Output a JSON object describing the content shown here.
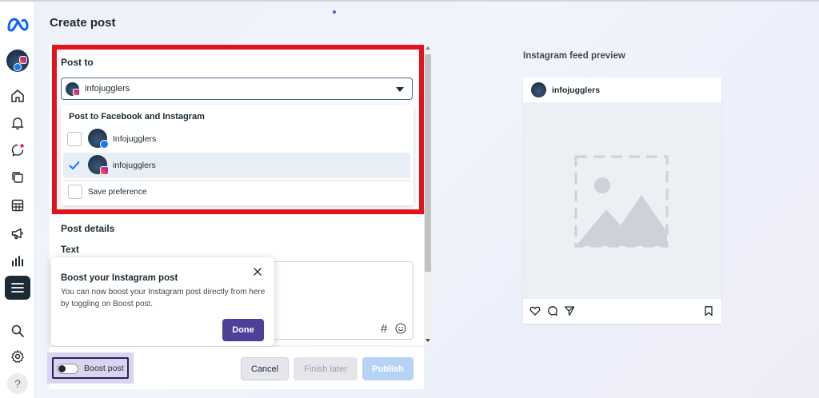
{
  "page": {
    "title": "Create post"
  },
  "sidebar": {
    "items": [
      {
        "icon": "home-icon"
      },
      {
        "icon": "bell-icon"
      },
      {
        "icon": "chat-icon"
      },
      {
        "icon": "stack-icon"
      },
      {
        "icon": "table-icon"
      },
      {
        "icon": "megaphone-icon"
      },
      {
        "icon": "bar-chart-icon"
      },
      {
        "icon": "menu-icon"
      },
      {
        "icon": "search-icon"
      },
      {
        "icon": "gear-icon"
      }
    ],
    "help_label": "?"
  },
  "composer": {
    "post_to_label": "Post to",
    "selected_account": "infojugglers",
    "dropdown": {
      "heading": "Post to Facebook and Instagram",
      "options": [
        {
          "label": "Infojugglers",
          "platform": "facebook",
          "checked": false
        },
        {
          "label": "infojugglers",
          "platform": "instagram",
          "checked": true
        }
      ],
      "save_preference_label": "Save preference"
    },
    "post_details_label": "Post details",
    "text_label": "Text",
    "text_value": "",
    "hashtag_symbol": "#"
  },
  "tooltip": {
    "title": "Boost your Instagram post",
    "body": "You can now boost your Instagram post directly from here by toggling on Boost post.",
    "done_label": "Done"
  },
  "footer": {
    "boost_label": "Boost post",
    "boost_on": false,
    "cancel_label": "Cancel",
    "finish_later_label": "Finish later",
    "publish_label": "Publish"
  },
  "preview": {
    "label": "Instagram feed preview",
    "account_name": "infojugglers"
  },
  "colors": {
    "highlight": "#e3131c",
    "primary_button": "#4e3f99",
    "publish_disabled": "#b6d3f5",
    "sidebar_active": "#1c2b33"
  }
}
